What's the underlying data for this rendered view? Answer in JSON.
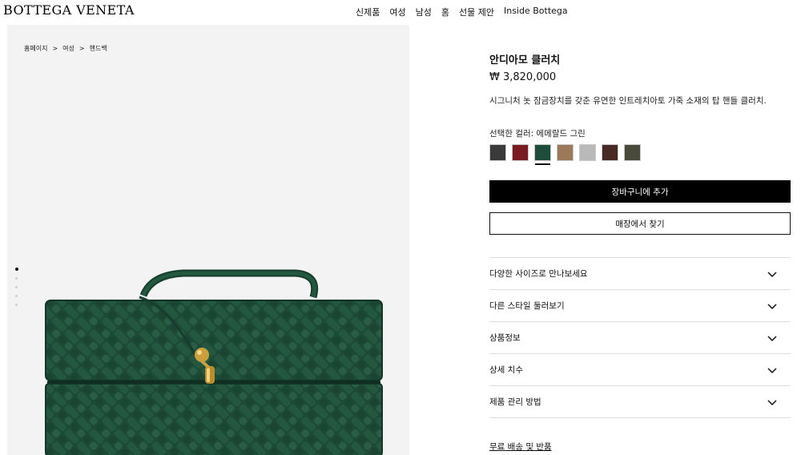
{
  "header": {
    "logo": "BOTTEGA VENETA",
    "nav": [
      "신제품",
      "여성",
      "남성",
      "홈",
      "선물 제안",
      "Inside Bottega"
    ]
  },
  "breadcrumb": {
    "items": [
      "홈페이지",
      "여성",
      "핸드백"
    ],
    "separator": ">"
  },
  "product": {
    "name": "안디아모 클러치",
    "price": "₩ 3,820,000",
    "description": "시그니처 놋 잠금장치를 갖춘 유연한 인트레치아토 가죽 소재의 탑 핸들 클러치.",
    "selected_color_label": "선택한 컬러: 에메랄드 그린",
    "swatches": [
      {
        "color": "#3a3a3a",
        "name": "black"
      },
      {
        "color": "#7a1b24",
        "name": "burgundy"
      },
      {
        "color": "#1e4d3a",
        "name": "emerald-green",
        "selected": true
      },
      {
        "color": "#9a7a5a",
        "name": "taupe"
      },
      {
        "color": "#b9b9b9",
        "name": "light-grey"
      },
      {
        "color": "#4a2a24",
        "name": "dark-brown"
      },
      {
        "color": "#4a4a3c",
        "name": "olive"
      }
    ],
    "image_dots": 5,
    "active_dot": 0
  },
  "buttons": {
    "add_to_cart": "장바구니에 추가",
    "find_in_store": "매장에서 찾기"
  },
  "accordion": [
    "다양한 사이즈로 만나보세요",
    "다른 스타일 둘러보기",
    "상품정보",
    "상세 치수",
    "제품 관리 방법"
  ],
  "footer_link": "무료 배송 및 반품",
  "colors": {
    "accent": "#000000",
    "bag_green": "#1e4d3a",
    "hardware_gold": "#c9a03c"
  }
}
